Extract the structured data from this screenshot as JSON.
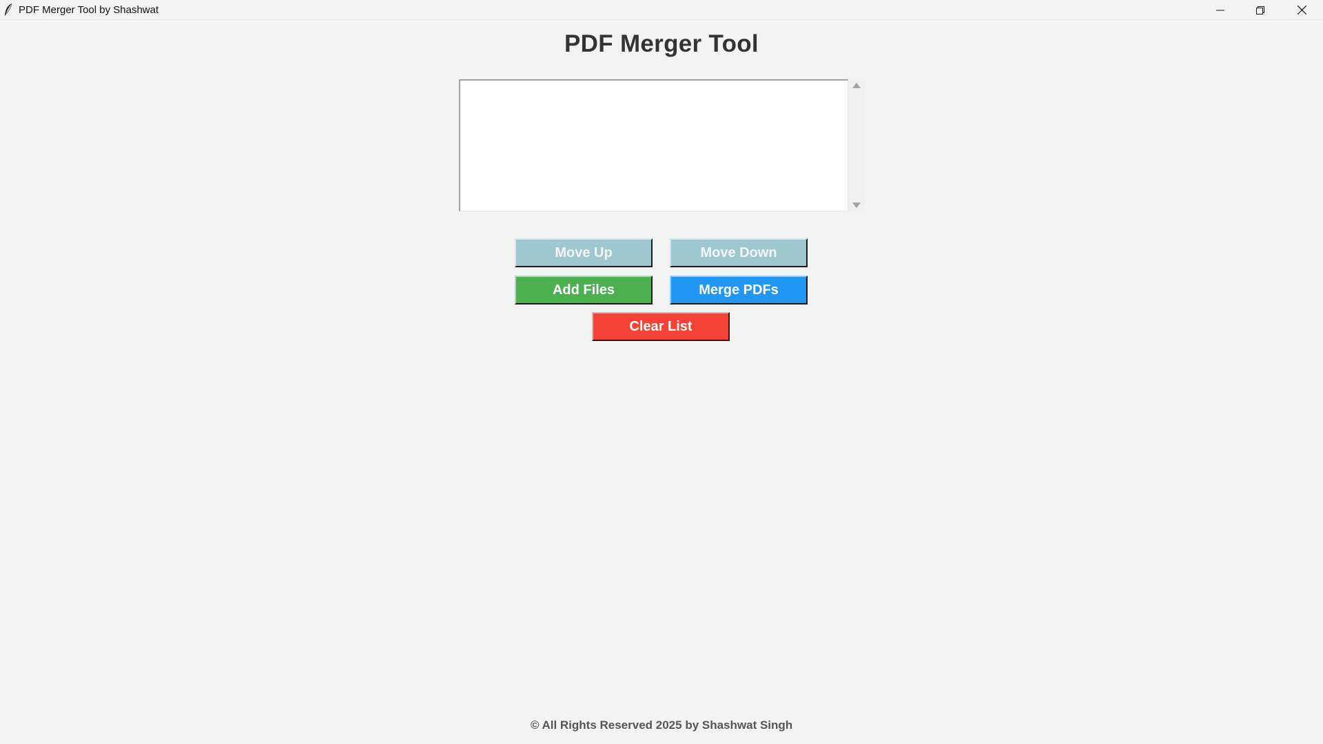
{
  "window": {
    "title": "PDF Merger Tool by Shashwat",
    "app_icon": "feather-icon",
    "controls": {
      "minimize_icon": "minimize-icon",
      "maximize_icon": "restore-icon",
      "close_icon": "close-icon"
    }
  },
  "main": {
    "title": "PDF Merger Tool",
    "file_list": {
      "items": []
    },
    "buttons": {
      "move_up": "Move Up",
      "move_down": "Move Down",
      "add_files": "Add Files",
      "merge_pdfs": "Merge PDFs",
      "clear_list": "Clear List"
    }
  },
  "footer": {
    "text": "© All Rights Reserved 2025 by Shashwat Singh"
  },
  "colors": {
    "background": "#f3f3f3",
    "move_buttons": "#9ec7cf",
    "add_files": "#4caf50",
    "merge_pdfs": "#2196f3",
    "clear_list": "#f44336"
  }
}
